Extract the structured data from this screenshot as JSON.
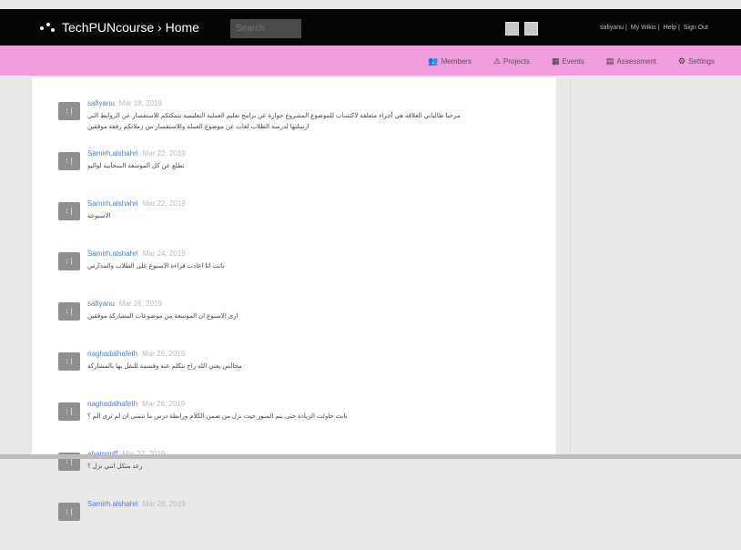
{
  "header": {
    "title": "TechPUNcourse › Home",
    "search_placeholder": "Search",
    "links": [
      "safiyanu",
      "My Wikis",
      "Help",
      "Sign Out"
    ]
  },
  "nav": [
    {
      "icon": "members-icon",
      "glyph": "👥",
      "label": "Members"
    },
    {
      "icon": "projects-icon",
      "glyph": "⚠",
      "label": "Projects"
    },
    {
      "icon": "events-icon",
      "glyph": "▦",
      "label": "Events"
    },
    {
      "icon": "assessment-icon",
      "glyph": "▤",
      "label": "Assessment"
    },
    {
      "icon": "settings-icon",
      "glyph": "⚙",
      "label": "Settings"
    }
  ],
  "feed": [
    {
      "user": "safiyanu",
      "date": "Mar 18, 2019",
      "text": "مرحبا طالباتي العلاقة هي أجزاء متعلقة لاكتساب للموضوع المشروع حوارة عن برامج تعليم العملية التعليمية بتمكنكم للاستفسار عن الروابط التي ارسلتها لدرسة الطلاب لغات عن موضوع العملة وللاستفسار من زملائكم رفقة موفقين"
    },
    {
      "user": "Samirh.alshahri",
      "date": "Mar 22, 2019",
      "text": "تطلع عن كل الموسعة السحابية لواليو"
    },
    {
      "user": "Samirh.alshahri",
      "date": "Mar 22, 2019",
      "text": "الاسبوعة"
    },
    {
      "user": "Samirh.alshahri",
      "date": "Mar 24, 2019",
      "text": "بانت انا اعادت قراءة الاسبوع على الطلاب والمدارس"
    },
    {
      "user": "safiyanu",
      "date": "Mar 26, 2019",
      "text": "ارى الاسبوع ان الموسعة من موضوعات المشاركة موفقين"
    },
    {
      "user": "naghadalhafeth",
      "date": "Mar 26, 2019",
      "text": "مجالس يعني الله راح نتكلم عنه وقسمة للنقل بها بالمشاركة"
    },
    {
      "user": "naghadalhafeth",
      "date": "Mar 26, 2019",
      "text": "بانت حاولت الزيادة حتى يتم المنور حيث نزل من ضمن الكلام ورابطة درس ما نتمنى ان لم ترى الم ؟"
    },
    {
      "user": "ahamouff",
      "date": "Mar 27, 2019",
      "text": "رعد متكل انني نزل ؟"
    },
    {
      "user": "Samirh.alshahri",
      "date": "Mar 28, 2019",
      "text": ""
    }
  ]
}
